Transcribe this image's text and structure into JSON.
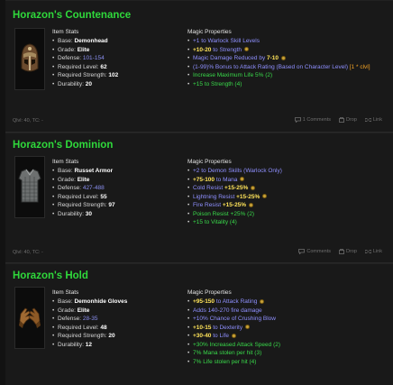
{
  "items": [
    {
      "name": "Horazon's Countenance",
      "stats_heading": "Item Stats",
      "props_heading": "Magic Properties",
      "stats": [
        {
          "key": "Base: ",
          "value": "Demonhead",
          "range": false
        },
        {
          "key": "Grade: ",
          "value": "Elite",
          "range": false
        },
        {
          "key": "Defense: ",
          "value": "101-154",
          "range": true
        },
        {
          "key": "Required Level: ",
          "value": "62",
          "range": false
        },
        {
          "key": "Required Strength: ",
          "value": "102",
          "range": false
        },
        {
          "key": "Durability: ",
          "value": "20",
          "range": false
        }
      ],
      "props": [
        {
          "parts": [
            {
              "t": "+1 to Warlock Skill Levels",
              "c": "p-blue"
            }
          ],
          "coin": false
        },
        {
          "parts": [
            {
              "t": "+10-20",
              "c": "p-yellow"
            },
            {
              "t": " to Strength",
              "c": "p-blue"
            }
          ],
          "coin": true
        },
        {
          "parts": [
            {
              "t": "Magic Damage Reduced by ",
              "c": "p-blue"
            },
            {
              "t": "7-10",
              "c": "p-yellow"
            }
          ],
          "coin": true
        },
        {
          "parts": [
            {
              "t": "(1-99)% Bonus to Attack Rating (Based on Character Level) ",
              "c": "p-blue"
            },
            {
              "t": "[1 * clvl]",
              "c": "p-orange"
            }
          ],
          "coin": false
        },
        {
          "parts": [
            {
              "t": "Increase Maximum Life 5% (2)",
              "c": "p-green"
            }
          ],
          "coin": false
        },
        {
          "parts": [
            {
              "t": "+15 to Strength (4)",
              "c": "p-green"
            }
          ],
          "coin": false
        }
      ],
      "footer_left": "Qlvl: 40,  TC: -",
      "comments_label": "1 Comments",
      "drop_label": "Drop",
      "link_label": "Link"
    },
    {
      "name": "Horazon's Dominion",
      "stats_heading": "Item Stats",
      "props_heading": "Magic Properties",
      "stats": [
        {
          "key": "Base: ",
          "value": "Russet Armor",
          "range": false
        },
        {
          "key": "Grade: ",
          "value": "Elite",
          "range": false
        },
        {
          "key": "Defense: ",
          "value": "427-488",
          "range": true
        },
        {
          "key": "Required Level: ",
          "value": "55",
          "range": false
        },
        {
          "key": "Required Strength: ",
          "value": "97",
          "range": false
        },
        {
          "key": "Durability: ",
          "value": "30",
          "range": false
        }
      ],
      "props": [
        {
          "parts": [
            {
              "t": "+2 to Demon Skills (Warlock Only)",
              "c": "p-blue"
            }
          ],
          "coin": false
        },
        {
          "parts": [
            {
              "t": "+75-100",
              "c": "p-yellow"
            },
            {
              "t": " to Mana",
              "c": "p-blue"
            }
          ],
          "coin": true
        },
        {
          "parts": [
            {
              "t": "Cold Resist ",
              "c": "p-blue"
            },
            {
              "t": "+15-25%",
              "c": "p-yellow"
            }
          ],
          "coin": true
        },
        {
          "parts": [
            {
              "t": "Lightning Resist ",
              "c": "p-blue"
            },
            {
              "t": "+15-25%",
              "c": "p-yellow"
            }
          ],
          "coin": true
        },
        {
          "parts": [
            {
              "t": "Fire Resist ",
              "c": "p-blue"
            },
            {
              "t": "+15-25%",
              "c": "p-yellow"
            }
          ],
          "coin": true
        },
        {
          "parts": [
            {
              "t": "Poison Resist +25% (2)",
              "c": "p-green"
            }
          ],
          "coin": false
        },
        {
          "parts": [
            {
              "t": "+15 to Vitality (4)",
              "c": "p-green"
            }
          ],
          "coin": false
        }
      ],
      "footer_left": "Qlvl: 40,  TC: -",
      "comments_label": "Comments",
      "drop_label": "Drop",
      "link_label": "Link"
    },
    {
      "name": "Horazon's Hold",
      "stats_heading": "Item Stats",
      "props_heading": "Magic Properties",
      "stats": [
        {
          "key": "Base: ",
          "value": "Demonhide Gloves",
          "range": false
        },
        {
          "key": "Grade: ",
          "value": "Elite",
          "range": false
        },
        {
          "key": "Defense: ",
          "value": "28-35",
          "range": true
        },
        {
          "key": "Required Level: ",
          "value": "48",
          "range": false
        },
        {
          "key": "Required Strength: ",
          "value": "20",
          "range": false
        },
        {
          "key": "Durability: ",
          "value": "12",
          "range": false
        }
      ],
      "props": [
        {
          "parts": [
            {
              "t": "+95-150",
              "c": "p-yellow"
            },
            {
              "t": " to Attack Rating",
              "c": "p-blue"
            }
          ],
          "coin": true
        },
        {
          "parts": [
            {
              "t": "Adds 140-270 fire damage",
              "c": "p-blue"
            }
          ],
          "coin": false
        },
        {
          "parts": [
            {
              "t": "+10% Chance of Crushing Blow",
              "c": "p-blue"
            }
          ],
          "coin": false
        },
        {
          "parts": [
            {
              "t": "+10-15",
              "c": "p-yellow"
            },
            {
              "t": " to Dexterity",
              "c": "p-blue"
            }
          ],
          "coin": true
        },
        {
          "parts": [
            {
              "t": "+30-40",
              "c": "p-yellow"
            },
            {
              "t": " to Life",
              "c": "p-blue"
            }
          ],
          "coin": true
        },
        {
          "parts": [
            {
              "t": "+30% Increased Attack Speed (2)",
              "c": "p-green"
            }
          ],
          "coin": false
        },
        {
          "parts": [
            {
              "t": "7% Mana stolen per hit (3)",
              "c": "p-green"
            }
          ],
          "coin": false
        },
        {
          "parts": [
            {
              "t": "7% Life stolen per hit (4)",
              "c": "p-green"
            }
          ],
          "coin": false
        }
      ]
    }
  ]
}
